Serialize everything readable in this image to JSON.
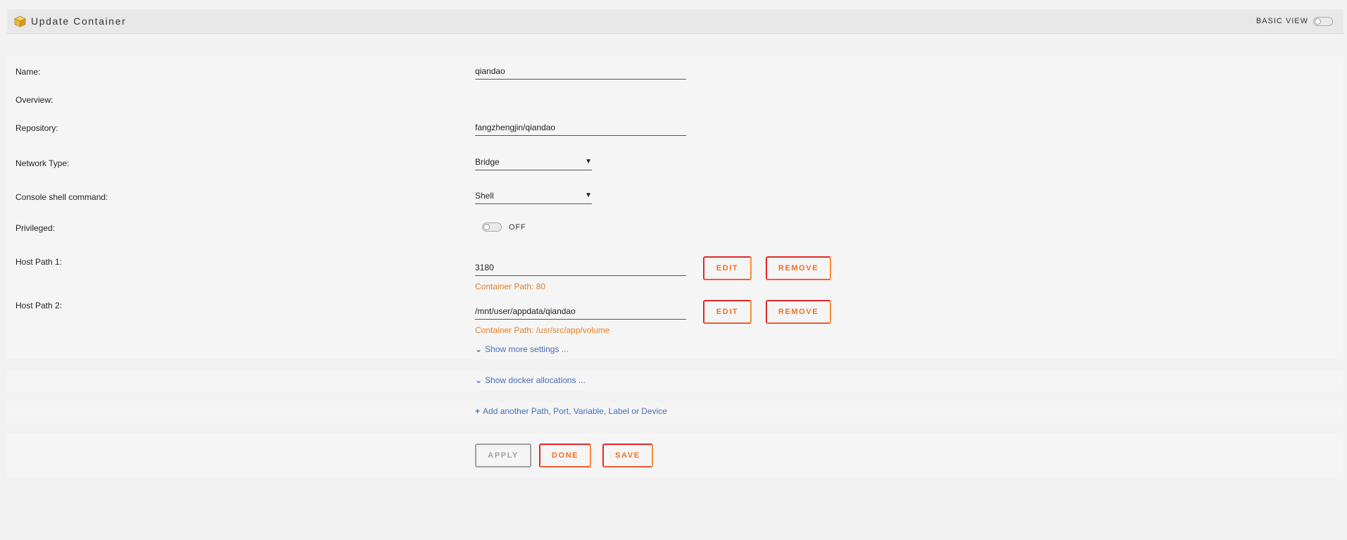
{
  "header": {
    "title": "Update Container",
    "icon": "docker-box-icon",
    "view_toggle_label": "BASIC VIEW"
  },
  "form": {
    "name": {
      "label": "Name:",
      "value": "qiandao"
    },
    "overview": {
      "label": "Overview:"
    },
    "repository": {
      "label": "Repository:",
      "value": "fangzhengjin/qiandao"
    },
    "network_type": {
      "label": "Network Type:",
      "value": "Bridge"
    },
    "console_shell": {
      "label": "Console shell command:",
      "value": "Shell"
    },
    "privileged": {
      "label": "Privileged:",
      "state": "OFF"
    },
    "host_paths": [
      {
        "label": "Host Path 1:",
        "value": "3180",
        "container_path": "Container Path: 80",
        "edit_label": "EDIT",
        "remove_label": "REMOVE"
      },
      {
        "label": "Host Path 2:",
        "value": "/mnt/user/appdata/qiandao",
        "container_path": "Container Path: /usr/src/app/volume",
        "edit_label": "EDIT",
        "remove_label": "REMOVE"
      }
    ],
    "show_more": "Show more settings ..."
  },
  "allocations": {
    "link": "Show docker allocations ..."
  },
  "add": {
    "link": "Add another Path, Port, Variable, Label or Device"
  },
  "actions": {
    "apply": "APPLY",
    "done": "DONE",
    "save": "SAVE"
  },
  "colors": {
    "accent_orange": "#f2701e",
    "accent_red": "#e22828",
    "link_blue": "#486dba",
    "container_path_orange": "#e67e22"
  }
}
